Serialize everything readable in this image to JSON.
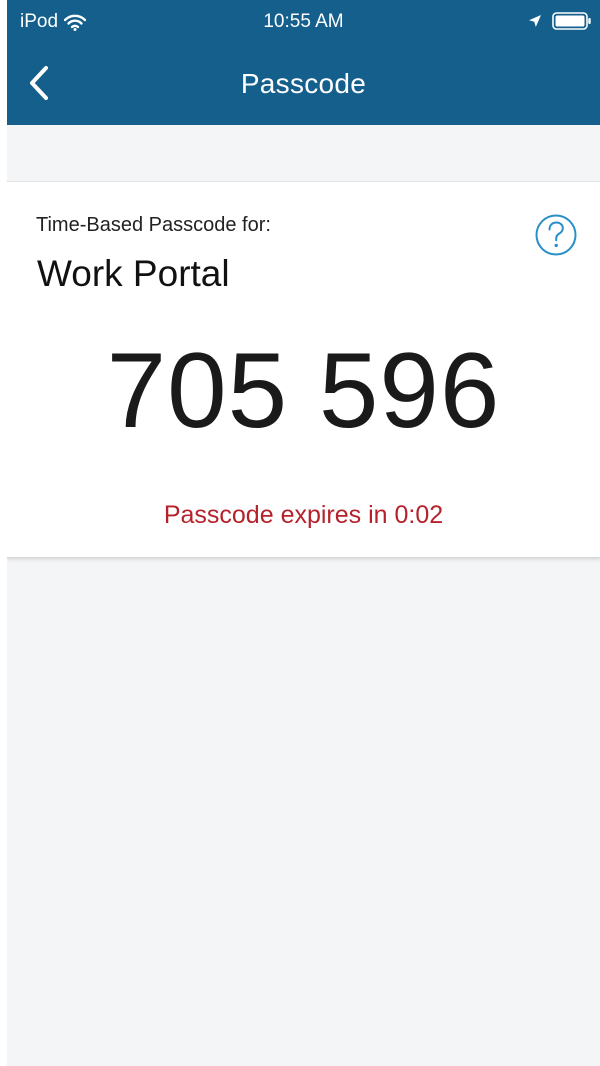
{
  "status_bar": {
    "carrier": "iPod",
    "time": "10:55 AM",
    "icons": [
      "wifi-icon",
      "location-arrow-icon",
      "battery-icon"
    ]
  },
  "nav": {
    "title": "Passcode",
    "back_icon": "chevron-left-icon"
  },
  "card": {
    "label": "Time-Based Passcode for:",
    "account_name": "Work Portal",
    "passcode": "705 596",
    "expiry_text": "Passcode expires in 0:02",
    "help_icon": "question-circle-icon"
  },
  "colors": {
    "header_bg": "#145f8c",
    "accent": "#2a8fc7",
    "expiry": "#b5222b",
    "background": "#f4f5f7"
  }
}
